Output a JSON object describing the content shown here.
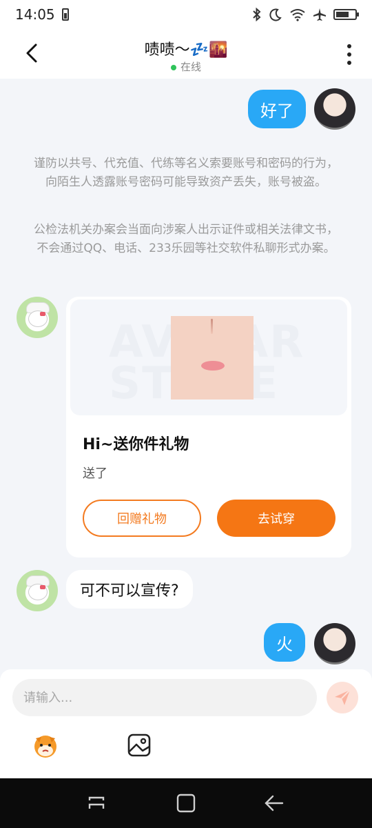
{
  "status_bar": {
    "time": "14:05",
    "icons": [
      "battery-saver-icon",
      "bluetooth-icon",
      "moon-icon",
      "wifi-icon",
      "airplane-icon",
      "battery-icon"
    ]
  },
  "header": {
    "title": "啧啧～",
    "title_emoji": "💤🌇",
    "status": "在线",
    "status_color": "#2fc35a"
  },
  "messages": {
    "m1_text": "好了",
    "notice_1": "谨防以共号、代充值、代练等名义索要账号和密码的行为，向陌生人透露账号密码可能导致资产丢失，账号被盗。",
    "notice_2": "公检法机关办案会当面向涉案人出示证件或相关法律文书，不会通过QQ、电话、233乐园等社交软件私聊形式办案。",
    "gift": {
      "watermark": "AVATAR STORE",
      "title": "Hi~送你件礼物",
      "subtitle": "送了",
      "return_gift_label": "回赠礼物",
      "try_on_label": "去试穿"
    },
    "m3_text": "可不可以宣传?",
    "m4_text": "火"
  },
  "input": {
    "placeholder": "请输入..."
  },
  "colors": {
    "accent_orange": "#f57614",
    "self_bubble": "#29a8f6",
    "background": "#f3f5f9"
  }
}
